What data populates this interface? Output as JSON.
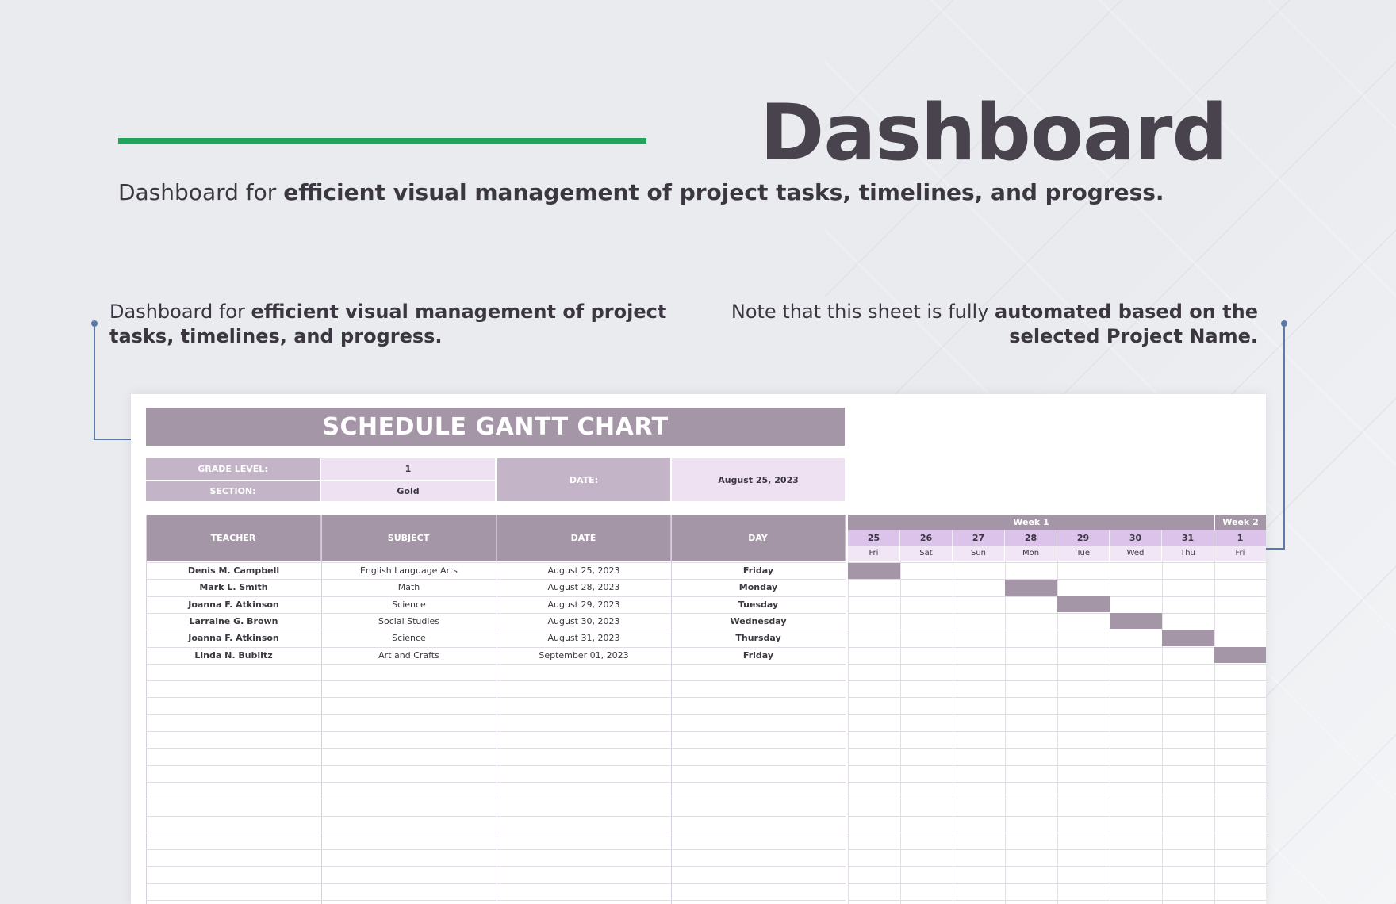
{
  "page": {
    "title": "Dashboard",
    "subtitle_plain": "Dashboard for ",
    "subtitle_bold": "efficient visual management of project tasks, timelines, and progress.",
    "note_left_plain": "Dashboard for ",
    "note_left_bold": "efficient visual management of project tasks, timelines, and progress.",
    "note_right_plain": "Note that this sheet is fully ",
    "note_right_bold": "automated based on the selected Project Name.",
    "accent_color": "#21a35b",
    "header_color": "#a496a6"
  },
  "sheet": {
    "banner": "SCHEDULE GANTT CHART",
    "grade_label": "GRADE LEVEL:",
    "grade_value": "1",
    "section_label": "SECTION:",
    "section_value": "Gold",
    "date_label": "DATE:",
    "date_value": "August 25, 2023",
    "columns": [
      "TEACHER",
      "SUBJECT",
      "DATE",
      "DAY"
    ],
    "rows": [
      {
        "teacher": "Denis M. Campbell",
        "subject": "English Language Arts",
        "date": "August 25, 2023",
        "day": "Friday"
      },
      {
        "teacher": "Mark L. Smith",
        "subject": "Math",
        "date": "August 28, 2023",
        "day": "Monday"
      },
      {
        "teacher": "Joanna F. Atkinson",
        "subject": "Science",
        "date": "August 29, 2023",
        "day": "Tuesday"
      },
      {
        "teacher": "Larraine G. Brown",
        "subject": "Social Studies",
        "date": "August 30, 2023",
        "day": "Wednesday"
      },
      {
        "teacher": "Joanna F. Atkinson",
        "subject": "Science",
        "date": "August 31, 2023",
        "day": "Thursday"
      },
      {
        "teacher": "Linda N. Bublitz",
        "subject": "Art and Crafts",
        "date": "September 01, 2023",
        "day": "Friday"
      }
    ]
  },
  "gantt": {
    "week1": "Week 1",
    "week2": "Week 2",
    "days": [
      {
        "num": "25",
        "name": "Fri"
      },
      {
        "num": "26",
        "name": "Sat"
      },
      {
        "num": "27",
        "name": "Sun"
      },
      {
        "num": "28",
        "name": "Mon"
      },
      {
        "num": "29",
        "name": "Tue"
      },
      {
        "num": "30",
        "name": "Wed"
      },
      {
        "num": "31",
        "name": "Thu"
      },
      {
        "num": "1",
        "name": "Fri"
      }
    ],
    "bars": [
      0,
      3,
      4,
      5,
      6,
      7
    ]
  }
}
